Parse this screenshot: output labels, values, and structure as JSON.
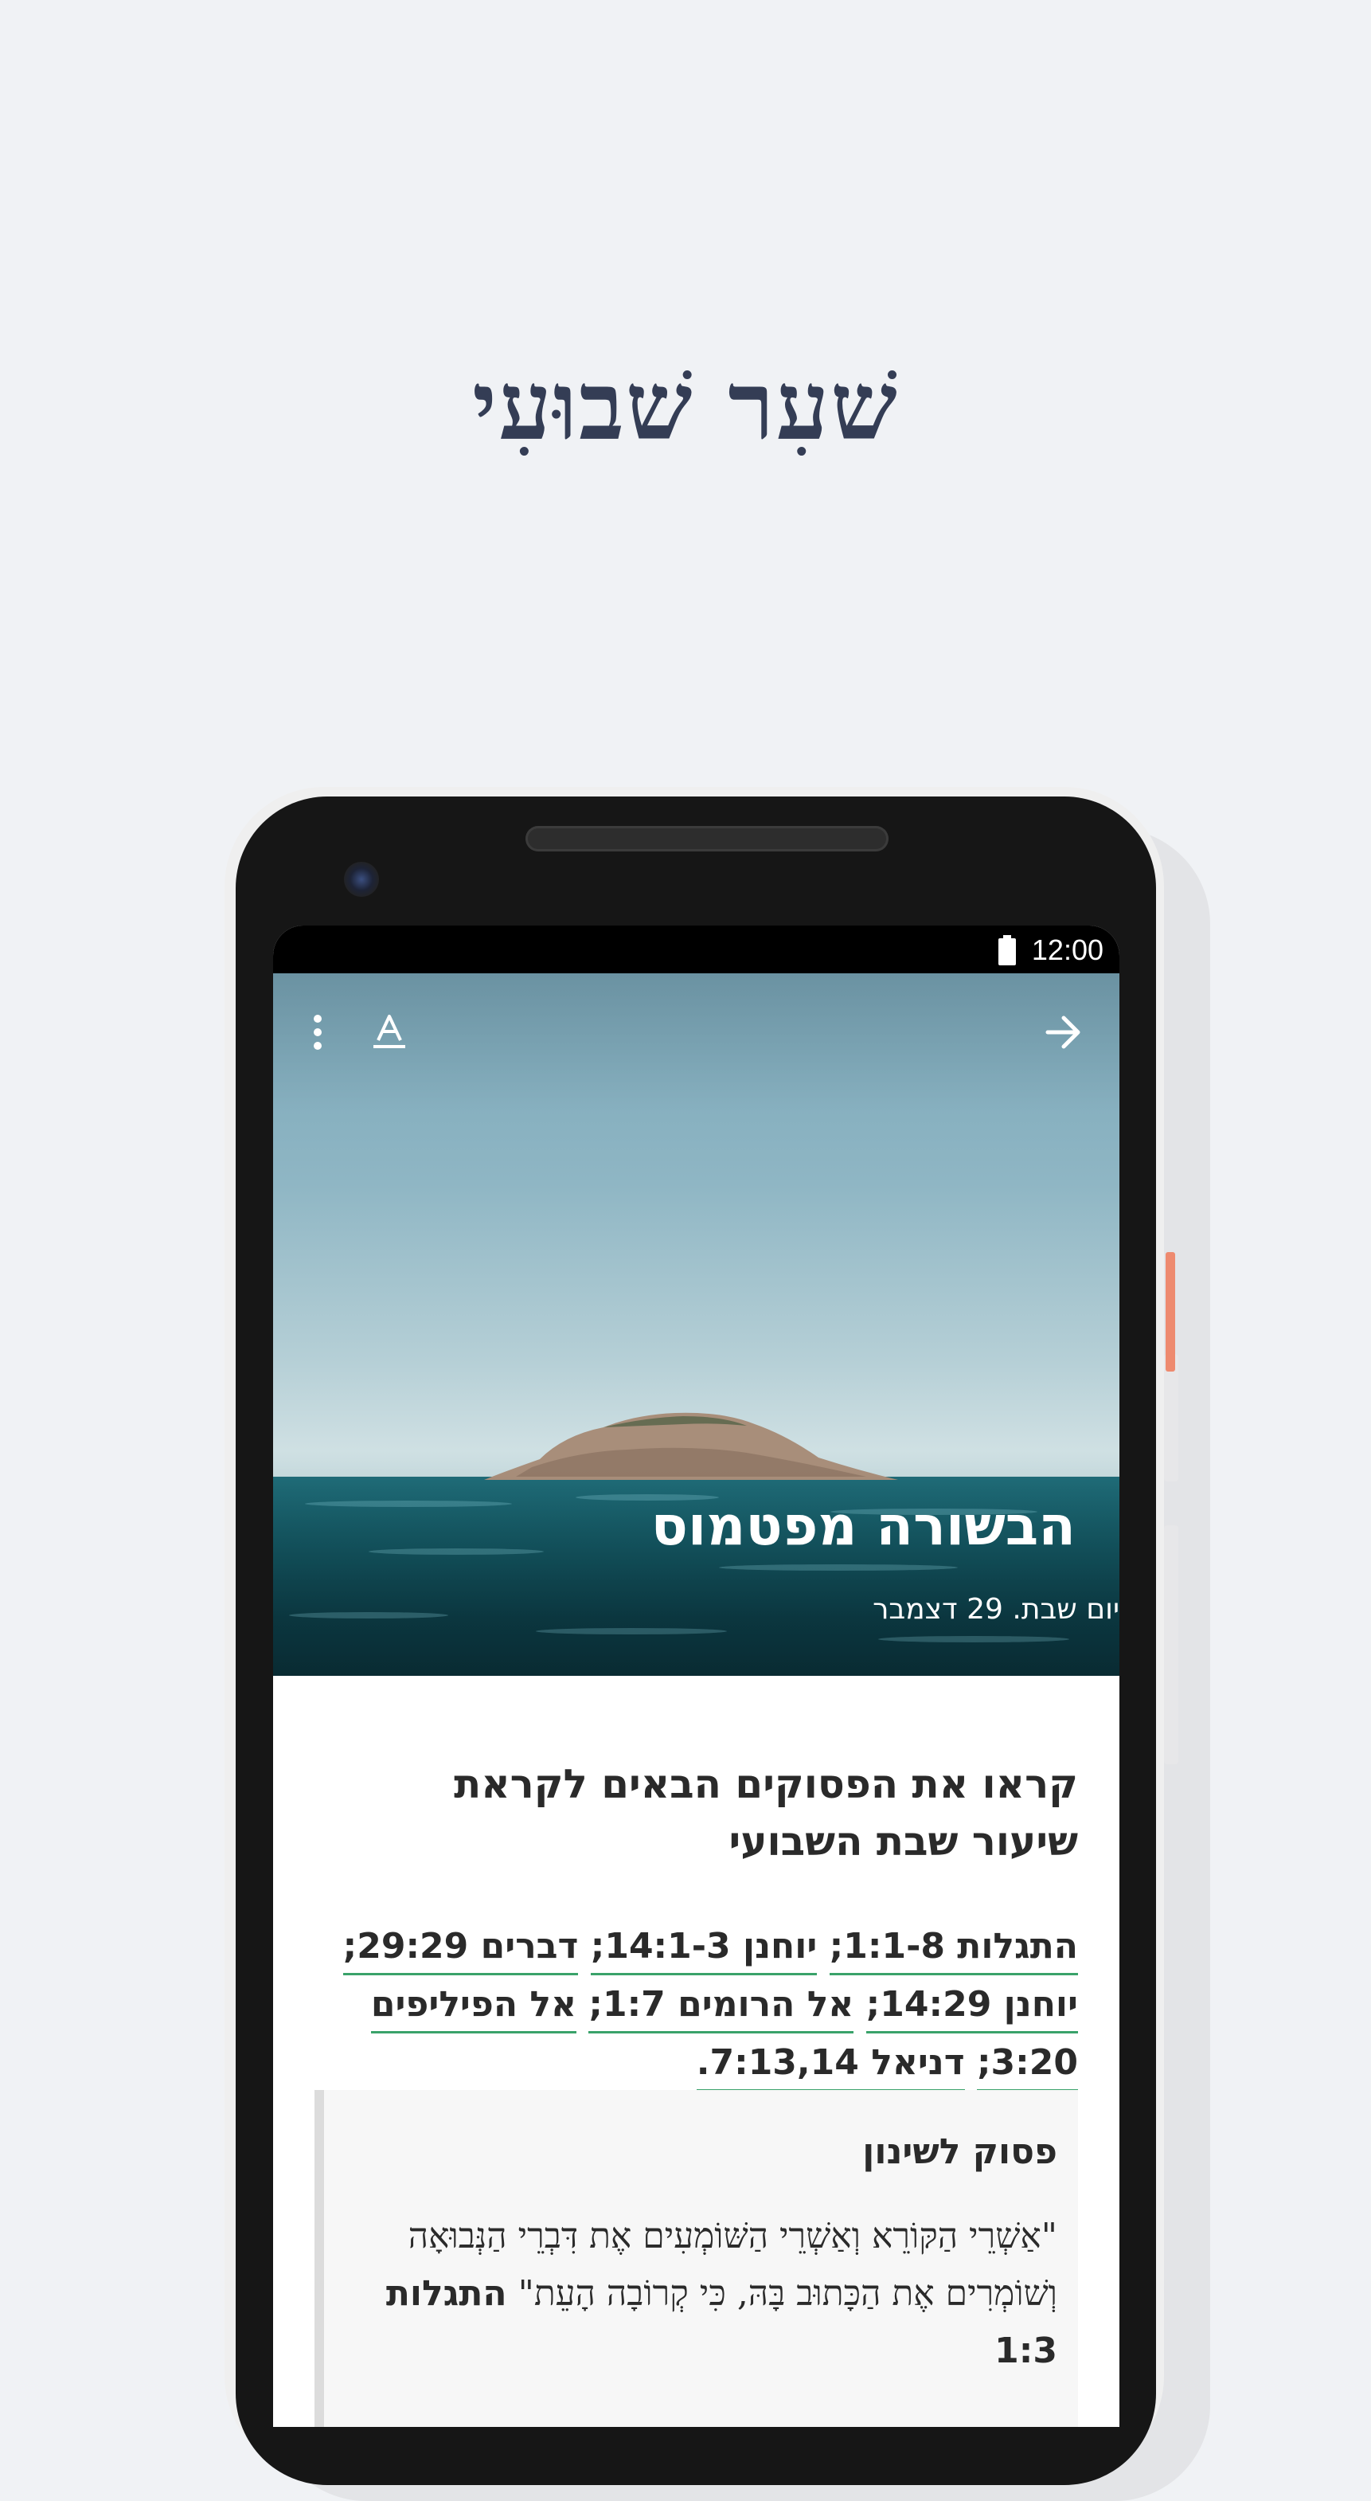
{
  "page": {
    "title": "שׁעִר שׁבוּעִי"
  },
  "status_bar": {
    "time": "12:00",
    "battery_icon": "battery-full-icon"
  },
  "toolbar": {
    "menu_icon": "more-vertical-icon",
    "font_icon": "text-format-icon",
    "forward_icon": "arrow-right-icon"
  },
  "hero": {
    "title": "הבשורה מפטמוס",
    "date": "יום שבת. 29 דצמבר"
  },
  "lesson": {
    "heading": "קראו את הפסוקים הבאים לקראת שיעור שבת השבועי",
    "references": [
      "התגלות 1:1-8;",
      "יוחנן 14:1-3;",
      "דברים 29:29;",
      "יוחנן 14:29;",
      "אל הרומים 1:7;",
      "אל הפיליפים 3:20;",
      "דניאל 7:13,14."
    ]
  },
  "memory_verse": {
    "title": "פסוק לשינון",
    "text": "\"אַשְׁרֵי הַקּוֹרֵא וְאַשְׁרֵי הַשּׁוֹמְעִים אֶת דִּבְרֵי הַנְּבוּאָה וְשׁוֹמְרִים אֶת הַכָּתוּב בָּהּ, כִּי קְרוֹבָה הָעֵת\"",
    "reference": "התגלות 1:3"
  }
}
